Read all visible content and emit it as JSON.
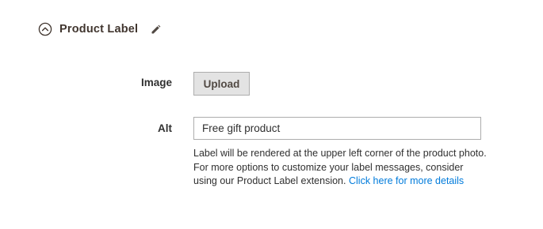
{
  "section": {
    "title": "Product Label",
    "collapse_icon": "collapse-circle-icon",
    "edit_icon": "pencil-icon"
  },
  "fields": {
    "image": {
      "label": "Image",
      "button_label": "Upload"
    },
    "alt": {
      "label": "Alt",
      "value": "Free gift product",
      "note_text": "Label will be rendered at the upper left corner of the product photo. For more options to customize your label messages, consider using our Product Label extension.",
      "note_link": "Click here for more details"
    }
  },
  "colors": {
    "link": "#007bdb",
    "button_bg": "#e3e3e3",
    "border": "#adadad"
  }
}
